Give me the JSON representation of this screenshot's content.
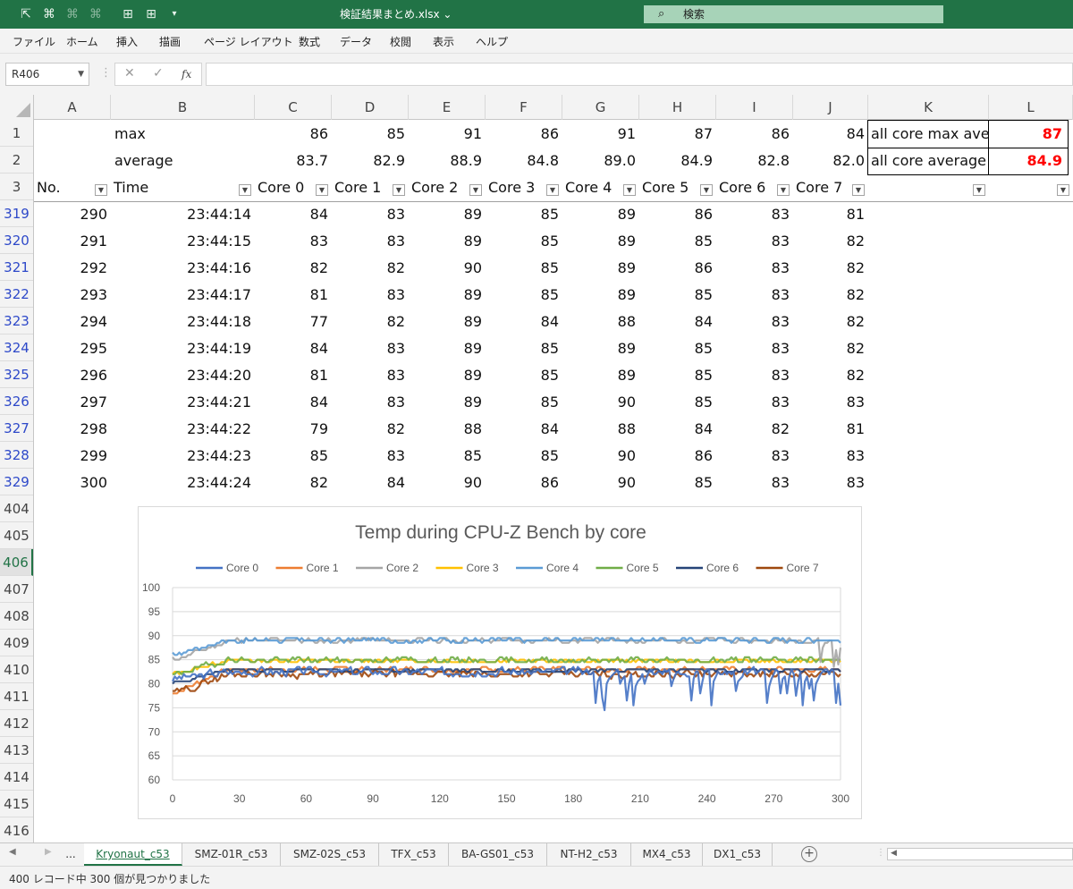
{
  "titlebar": {
    "filename": "検証結果まとめ.xlsx",
    "search_placeholder": "検索",
    "icons": [
      "select-cursor-icon",
      "crop-icon",
      "crop-dim-icon",
      "crop-dim-dd-icon",
      "grid-icon",
      "grid-plus-icon",
      "customize-icon"
    ]
  },
  "menu": [
    "ファイル",
    "ホーム",
    "挿入",
    "描画",
    "ページ レイアウト",
    "数式",
    "データ",
    "校閲",
    "表示",
    "ヘルプ"
  ],
  "formula_bar": {
    "name_box": "R406",
    "fx_label": "fx",
    "formula": ""
  },
  "columns": [
    "A",
    "B",
    "C",
    "D",
    "E",
    "F",
    "G",
    "H",
    "I",
    "J",
    "K",
    "L"
  ],
  "summary": {
    "max_label": "max",
    "max_values": [
      "86",
      "85",
      "91",
      "86",
      "91",
      "87",
      "86",
      "84"
    ],
    "avg_label": "average",
    "avg_values": [
      "83.7",
      "82.9",
      "88.9",
      "84.8",
      "89.0",
      "84.9",
      "82.8",
      "82.0"
    ],
    "all_core_max_label": "all core max ave",
    "all_core_max_value": "87",
    "all_core_avg_label": "all core average",
    "all_core_avg_value": "84.9"
  },
  "table_headers": [
    "No.",
    "Time",
    "Core 0",
    "Core 1",
    "Core 2",
    "Core 3",
    "Core 4",
    "Core 5",
    "Core 6",
    "Core 7"
  ],
  "row_numbers_top": [
    "1",
    "2",
    "3"
  ],
  "rows": [
    {
      "row": "319",
      "no": "290",
      "time": "23:44:14",
      "cores": [
        "84",
        "83",
        "89",
        "85",
        "89",
        "86",
        "83",
        "81"
      ]
    },
    {
      "row": "320",
      "no": "291",
      "time": "23:44:15",
      "cores": [
        "83",
        "83",
        "89",
        "85",
        "89",
        "85",
        "83",
        "82"
      ]
    },
    {
      "row": "321",
      "no": "292",
      "time": "23:44:16",
      "cores": [
        "82",
        "82",
        "90",
        "85",
        "89",
        "86",
        "83",
        "82"
      ]
    },
    {
      "row": "322",
      "no": "293",
      "time": "23:44:17",
      "cores": [
        "81",
        "83",
        "89",
        "85",
        "89",
        "85",
        "83",
        "82"
      ]
    },
    {
      "row": "323",
      "no": "294",
      "time": "23:44:18",
      "cores": [
        "77",
        "82",
        "89",
        "84",
        "88",
        "84",
        "83",
        "82"
      ]
    },
    {
      "row": "324",
      "no": "295",
      "time": "23:44:19",
      "cores": [
        "84",
        "83",
        "89",
        "85",
        "89",
        "85",
        "83",
        "82"
      ]
    },
    {
      "row": "325",
      "no": "296",
      "time": "23:44:20",
      "cores": [
        "81",
        "83",
        "89",
        "85",
        "89",
        "85",
        "83",
        "82"
      ]
    },
    {
      "row": "326",
      "no": "297",
      "time": "23:44:21",
      "cores": [
        "84",
        "83",
        "89",
        "85",
        "90",
        "85",
        "83",
        "83"
      ]
    },
    {
      "row": "327",
      "no": "298",
      "time": "23:44:22",
      "cores": [
        "79",
        "82",
        "88",
        "84",
        "88",
        "84",
        "82",
        "81"
      ]
    },
    {
      "row": "328",
      "no": "299",
      "time": "23:44:23",
      "cores": [
        "85",
        "83",
        "85",
        "85",
        "90",
        "86",
        "83",
        "83"
      ]
    },
    {
      "row": "329",
      "no": "300",
      "time": "23:44:24",
      "cores": [
        "82",
        "84",
        "90",
        "86",
        "90",
        "85",
        "83",
        "83"
      ]
    }
  ],
  "empty_rows": [
    "404",
    "405",
    "406",
    "407",
    "408",
    "409",
    "410",
    "411",
    "412",
    "413",
    "414",
    "415",
    "416"
  ],
  "chart_data": {
    "type": "line",
    "title": "Temp during CPU-Z Bench by core",
    "legend_position": "top",
    "xlim": [
      0,
      300
    ],
    "xticks": [
      "0",
      "30",
      "60",
      "90",
      "120",
      "150",
      "180",
      "210",
      "240",
      "270",
      "300"
    ],
    "ylim": [
      60,
      100
    ],
    "yticks": [
      "100",
      "95",
      "90",
      "85",
      "80",
      "75",
      "70",
      "65",
      "60"
    ],
    "grid": "horizontal",
    "series": [
      {
        "name": "Core 0",
        "color": "#4472c4",
        "base": 82.5,
        "start": 81,
        "noise": 1.2,
        "dips": [
          [
            190,
            300,
            4.5
          ]
        ],
        "seed": 3
      },
      {
        "name": "Core 1",
        "color": "#ed7d31",
        "base": 83,
        "start": 78,
        "noise": 0.6,
        "dips": [
          [
            80,
            82,
            4
          ]
        ],
        "seed": 7
      },
      {
        "name": "Core 2",
        "color": "#a5a5a5",
        "base": 89,
        "start": 85,
        "noise": 0.6,
        "dips": [
          [
            290,
            300,
            4
          ]
        ],
        "seed": 11
      },
      {
        "name": "Core 3",
        "color": "#ffc000",
        "base": 84.8,
        "start": 82,
        "noise": 0.5,
        "dips": [
          [
            80,
            82,
            5
          ]
        ],
        "seed": 13
      },
      {
        "name": "Core 4",
        "color": "#5b9bd5",
        "base": 89.1,
        "start": 86,
        "noise": 0.6,
        "dips": [],
        "seed": 17
      },
      {
        "name": "Core 5",
        "color": "#70ad47",
        "base": 84.9,
        "start": 82,
        "noise": 0.8,
        "dips": [],
        "seed": 19
      },
      {
        "name": "Core 6",
        "color": "#264478",
        "base": 82.8,
        "start": 80,
        "noise": 0.4,
        "dips": [],
        "seed": 23
      },
      {
        "name": "Core 7",
        "color": "#9e480e",
        "base": 82,
        "start": 78,
        "noise": 1.0,
        "dips": [],
        "seed": 29
      }
    ]
  },
  "sheet_tabs": [
    "Kryonaut_c53",
    "SMZ-01R_c53",
    "SMZ-02S_c53",
    "TFX_c53",
    "BA-GS01_c53",
    "NT-H2_c53",
    "MX4_c53",
    "DX1_c53"
  ],
  "sheet_tab_ellipsis": "...",
  "active_tab": "Kryonaut_c53",
  "status_text": "400 レコード中 300 個が見つかりました"
}
